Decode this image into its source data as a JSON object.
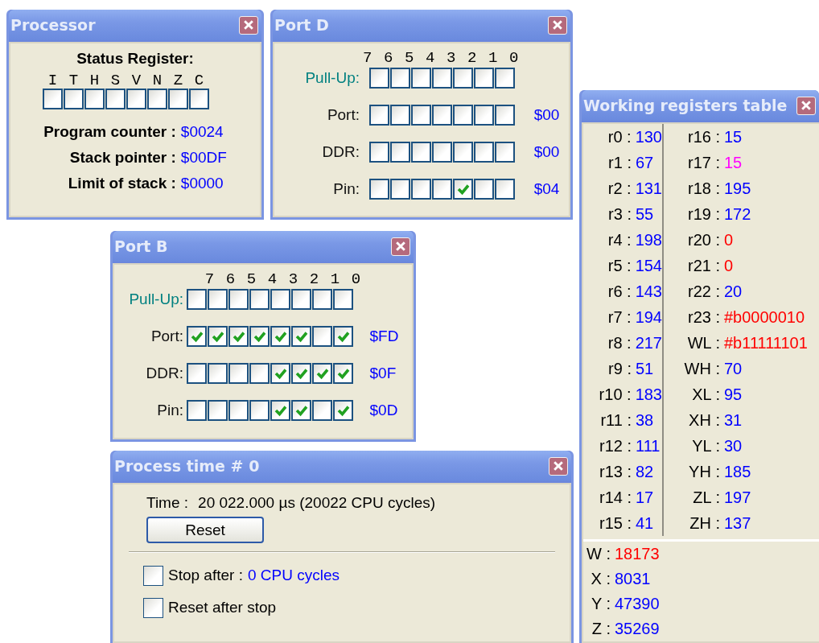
{
  "processor": {
    "title": "Processor",
    "heading": "Status Register:",
    "flags": [
      {
        "label": "I",
        "checked": false
      },
      {
        "label": "T",
        "checked": false
      },
      {
        "label": "H",
        "checked": false
      },
      {
        "label": "S",
        "checked": false
      },
      {
        "label": "V",
        "checked": false
      },
      {
        "label": "N",
        "checked": false
      },
      {
        "label": "Z",
        "checked": false
      },
      {
        "label": "C",
        "checked": false
      }
    ],
    "fields": [
      {
        "label": "Program counter :",
        "value": "$0024"
      },
      {
        "label": "Stack pointer :",
        "value": "$00DF"
      },
      {
        "label": "Limit of stack :",
        "value": "$0000"
      }
    ]
  },
  "port_d": {
    "title": "Port D",
    "bit_labels": [
      "7",
      "6",
      "5",
      "4",
      "3",
      "2",
      "1",
      "0"
    ],
    "rows": [
      {
        "kind": "pullup",
        "label": "Pull-Up:",
        "bits": [
          {
            "checked": false
          },
          {
            "checked": false
          },
          {
            "checked": false
          },
          {
            "checked": false
          },
          {
            "checked": false
          },
          {
            "checked": false
          },
          {
            "checked": false
          }
        ]
      },
      {
        "kind": "register",
        "label": "Port:",
        "value": "$00",
        "bits": [
          {
            "checked": false
          },
          {
            "checked": false
          },
          {
            "checked": false
          },
          {
            "checked": false
          },
          {
            "checked": false
          },
          {
            "checked": false
          },
          {
            "checked": false
          }
        ]
      },
      {
        "kind": "register",
        "label": "DDR:",
        "value": "$00",
        "bits": [
          {
            "checked": false
          },
          {
            "checked": false
          },
          {
            "checked": false
          },
          {
            "checked": false
          },
          {
            "checked": false
          },
          {
            "checked": false
          },
          {
            "checked": false
          }
        ]
      },
      {
        "kind": "register",
        "label": "Pin:",
        "value": "$04",
        "bits": [
          {
            "checked": false
          },
          {
            "checked": false
          },
          {
            "checked": false
          },
          {
            "checked": false
          },
          {
            "checked": true
          },
          {
            "checked": false
          },
          {
            "checked": false
          }
        ]
      }
    ]
  },
  "port_b": {
    "title": "Port B",
    "bit_labels": [
      "7",
      "6",
      "5",
      "4",
      "3",
      "2",
      "1",
      "0"
    ],
    "rows": [
      {
        "kind": "pullup",
        "label": "Pull-Up:",
        "bits": [
          {
            "checked": false
          },
          {
            "checked": false
          },
          {
            "checked": false
          },
          {
            "checked": false
          },
          {
            "checked": false
          },
          {
            "checked": false
          },
          {
            "checked": false
          },
          {
            "checked": false
          }
        ]
      },
      {
        "kind": "register",
        "label": "Port:",
        "value": "$FD",
        "bits": [
          {
            "checked": true
          },
          {
            "checked": true
          },
          {
            "checked": true
          },
          {
            "checked": true
          },
          {
            "checked": true
          },
          {
            "checked": true
          },
          {
            "checked": false
          },
          {
            "checked": true
          }
        ]
      },
      {
        "kind": "register",
        "label": "DDR:",
        "value": "$0F",
        "bits": [
          {
            "checked": false
          },
          {
            "checked": false
          },
          {
            "checked": false
          },
          {
            "checked": false
          },
          {
            "checked": true
          },
          {
            "checked": true
          },
          {
            "checked": true
          },
          {
            "checked": true
          }
        ]
      },
      {
        "kind": "register",
        "label": "Pin:",
        "value": "$0D",
        "bits": [
          {
            "checked": false
          },
          {
            "checked": false
          },
          {
            "checked": false
          },
          {
            "checked": false
          },
          {
            "checked": true
          },
          {
            "checked": true
          },
          {
            "checked": false
          },
          {
            "checked": true
          }
        ]
      }
    ]
  },
  "process_time": {
    "title": "Process time # 0",
    "time_label": "Time :",
    "time_value": "20 022.000 µs (20022 CPU cycles)",
    "reset_button": "Reset",
    "options": [
      {
        "label": "Stop after :",
        "value": "0 CPU cycles",
        "checked": false
      },
      {
        "label": "Reset after stop",
        "checked": false
      }
    ]
  },
  "registers": {
    "title": "Working registers table",
    "left": [
      {
        "name": "r0 :",
        "value": "130",
        "color": "#0000ff"
      },
      {
        "name": "r1 :",
        "value": "67",
        "color": "#0000ff"
      },
      {
        "name": "r2 :",
        "value": "131",
        "color": "#0000ff"
      },
      {
        "name": "r3 :",
        "value": "55",
        "color": "#0000ff"
      },
      {
        "name": "r4 :",
        "value": "198",
        "color": "#0000ff"
      },
      {
        "name": "r5 :",
        "value": "154",
        "color": "#0000ff"
      },
      {
        "name": "r6 :",
        "value": "143",
        "color": "#0000ff"
      },
      {
        "name": "r7 :",
        "value": "194",
        "color": "#0000ff"
      },
      {
        "name": "r8 :",
        "value": "217",
        "color": "#0000ff"
      },
      {
        "name": "r9 :",
        "value": "51",
        "color": "#0000ff"
      },
      {
        "name": "r10 :",
        "value": "183",
        "color": "#0000ff"
      },
      {
        "name": "r11 :",
        "value": "38",
        "color": "#0000ff"
      },
      {
        "name": "r12 :",
        "value": "111",
        "color": "#0000ff"
      },
      {
        "name": "r13 :",
        "value": "82",
        "color": "#0000ff"
      },
      {
        "name": "r14 :",
        "value": "17",
        "color": "#0000ff"
      },
      {
        "name": "r15 :",
        "value": "41",
        "color": "#0000ff"
      }
    ],
    "right": [
      {
        "name": "r16 :",
        "value": "15",
        "color": "#0000ff"
      },
      {
        "name": "r17 :",
        "value": "15",
        "color": "#ff00ff"
      },
      {
        "name": "r18 :",
        "value": "195",
        "color": "#0000ff"
      },
      {
        "name": "r19 :",
        "value": "172",
        "color": "#0000ff"
      },
      {
        "name": "r20 :",
        "value": "0",
        "color": "#ff0000"
      },
      {
        "name": "r21 :",
        "value": "0",
        "color": "#ff0000"
      },
      {
        "name": "r22 :",
        "value": "20",
        "color": "#0000ff"
      },
      {
        "name": "r23 :",
        "value": "#b0000010",
        "color": "#ff0000"
      },
      {
        "name": "WL :",
        "value": "#b11111101",
        "color": "#ff0000"
      },
      {
        "name": "WH :",
        "value": "70",
        "color": "#0000ff"
      },
      {
        "name": "XL :",
        "value": "95",
        "color": "#0000ff"
      },
      {
        "name": "XH :",
        "value": "31",
        "color": "#0000ff"
      },
      {
        "name": "YL :",
        "value": "30",
        "color": "#0000ff"
      },
      {
        "name": "YH :",
        "value": "185",
        "color": "#0000ff"
      },
      {
        "name": "ZL :",
        "value": "197",
        "color": "#0000ff"
      },
      {
        "name": "ZH :",
        "value": "137",
        "color": "#0000ff"
      }
    ],
    "pairs": [
      {
        "name": "W :",
        "value": "18173",
        "color": "#ff0000"
      },
      {
        "name": "X :",
        "value": "8031",
        "color": "#0000ff"
      },
      {
        "name": "Y :",
        "value": "47390",
        "color": "#0000ff"
      },
      {
        "name": "Z :",
        "value": "35269",
        "color": "#0000ff"
      }
    ]
  }
}
